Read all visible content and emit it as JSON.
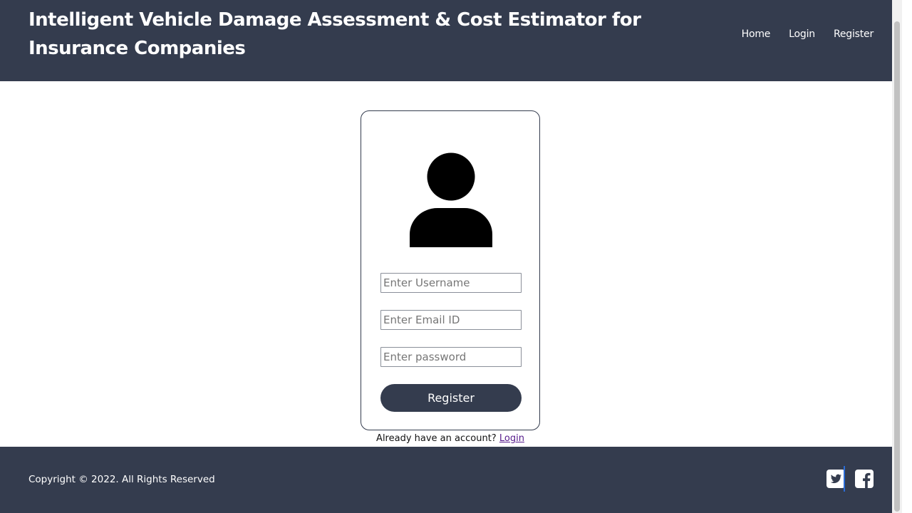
{
  "header": {
    "title": "Intelligent Vehicle Damage Assessment & Cost Estimator for Insurance Companies",
    "nav": [
      {
        "label": "Home",
        "icon": ""
      },
      {
        "label": "Login",
        "icon": ""
      },
      {
        "label": "Register",
        "icon": ""
      }
    ],
    "background_color": "#343c4e"
  },
  "form": {
    "avatar_icon": "user-icon",
    "username_placeholder": "Enter Username",
    "email_placeholder": "Enter Email ID",
    "password_placeholder": "Enter password",
    "submit_label": "Register"
  },
  "login_prompt": {
    "text": "Already have an account?",
    "link_label": "Login"
  },
  "footer": {
    "copyright": "Copyright © 2022. All Rights Reserved",
    "social": [
      {
        "icon": "twitter-icon"
      },
      {
        "icon": "facebook-icon"
      }
    ]
  },
  "colors": {
    "primary": "#343c4e",
    "link": "#551a8b",
    "social_divider": "#2a6bd6"
  }
}
